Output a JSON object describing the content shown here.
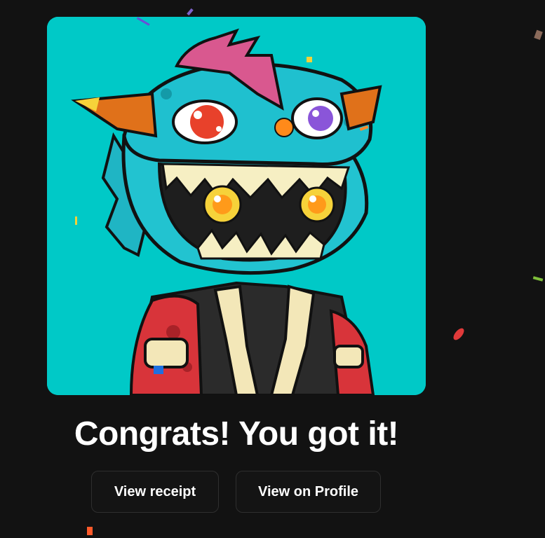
{
  "headline": "Congrats! You got it!",
  "actions": {
    "receipt_label": "View receipt",
    "profile_label": "View on Profile"
  },
  "colors": {
    "background": "#121212",
    "artwork_background": "#00c9c7",
    "button_border": "#2f2f2f",
    "text": "#ffffff"
  },
  "artwork": {
    "alt": "NFT artwork"
  },
  "confetti": [
    {
      "color": "#7d63c9"
    },
    {
      "color": "#6a4fd8"
    },
    {
      "color": "#f2d23a"
    },
    {
      "color": "#f2d23a"
    },
    {
      "color": "#8a6a5a"
    },
    {
      "color": "#ff8a2a"
    },
    {
      "color": "#7fbf3a"
    },
    {
      "color": "#e03a3a"
    },
    {
      "color": "#1e6fe0"
    },
    {
      "color": "#ff5a2a"
    }
  ]
}
